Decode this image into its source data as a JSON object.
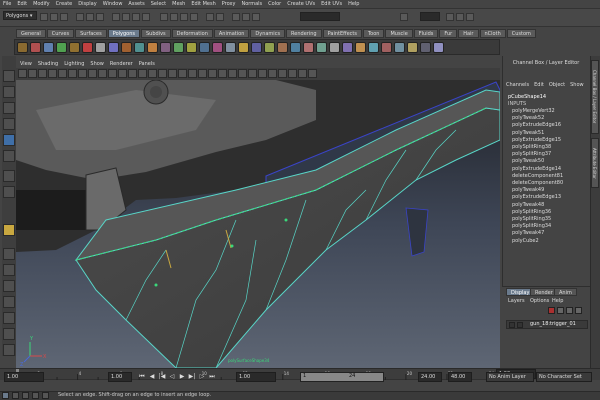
{
  "menubar": [
    "File",
    "Edit",
    "Modify",
    "Create",
    "Display",
    "Window",
    "Assets",
    "Select",
    "Mesh",
    "Edit Mesh",
    "Proxy",
    "Normals",
    "Color",
    "Create UVs",
    "Edit UVs",
    "Help"
  ],
  "status": {
    "mode": "Polygons"
  },
  "shelf": {
    "tabs": [
      "General",
      "Curves",
      "Surfaces",
      "Polygons",
      "Subdivs",
      "Deformation",
      "Animation",
      "Dynamics",
      "Rendering",
      "PaintEffects",
      "Toon",
      "Muscle",
      "Fluids",
      "Fur",
      "Hair",
      "nCloth",
      "Custom"
    ],
    "active": "Polygons",
    "icon_colors": [
      "#8a6a30",
      "#b05050",
      "#6080b0",
      "#50a050",
      "#907030",
      "#c04040",
      "#a0a0a0",
      "#7070c0",
      "#a06030",
      "#509090",
      "#c08040",
      "#806080",
      "#60a060",
      "#a0a040",
      "#507090",
      "#a05080",
      "#8090a0",
      "#c0a040",
      "#6060a0",
      "#90a050",
      "#a07050",
      "#5080a0",
      "#b07070",
      "#70a090",
      "#a0a0a0",
      "#8070b0",
      "#c09050",
      "#60a0b0",
      "#a06060",
      "#7090a0",
      "#b0a060",
      "#606070",
      "#9090c0"
    ]
  },
  "panel_menu": [
    "View",
    "Shading",
    "Lighting",
    "Show",
    "Renderer",
    "Panels"
  ],
  "viewport": {
    "annotation": "polySurfaceShape34",
    "axis_labels": {
      "x": "X",
      "y": "Y",
      "z": "Z"
    }
  },
  "channel_box": {
    "title": "Channel Box / Layer Editor",
    "menus": [
      "Channels",
      "Edit",
      "Object",
      "Show"
    ],
    "shape": "pCubeShape14",
    "inputs_label": "INPUTS",
    "inputs": [
      "polyMergeVert32",
      "polyTweak52",
      "polyExtrudeEdge16",
      "polyTweak51",
      "polyExtrudeEdge15",
      "polySplitRing38",
      "polySplitRing37",
      "polyTweak50",
      "polyExtrudeEdge14",
      "deleteComponent81",
      "deleteComponent80",
      "polyTweak49",
      "polyExtrudeEdge13",
      "polyTweak48",
      "polySplitRing36",
      "polySplitRing35",
      "polySplitRing34",
      "polyTweak47",
      "polyCube2"
    ]
  },
  "side_tabs": [
    "Channel Box / Layer Editor",
    "Attribute Editor"
  ],
  "layer_editor": {
    "tabs": [
      "Display",
      "Render",
      "Anim"
    ],
    "active": "Display",
    "menus": [
      "Layers",
      "Options",
      "Help"
    ],
    "layer": "gun_18:trigger_01"
  },
  "time": {
    "tick_labels": [
      "1",
      "2",
      "4",
      "6",
      "8",
      "10",
      "12",
      "14",
      "16",
      "18",
      "20",
      "22",
      "24"
    ],
    "current": "1.00"
  },
  "range": {
    "start": "1.00",
    "start2": "1.00",
    "inner_start": "1.00",
    "slider_value": "1",
    "slider_end": "24",
    "end": "24.00",
    "end2": "48.00",
    "anim_layer": "No Anim Layer",
    "char_set": "No Character Set"
  },
  "help_line": "Select an edge. Shift-drag on an edge to insert an edge loop."
}
